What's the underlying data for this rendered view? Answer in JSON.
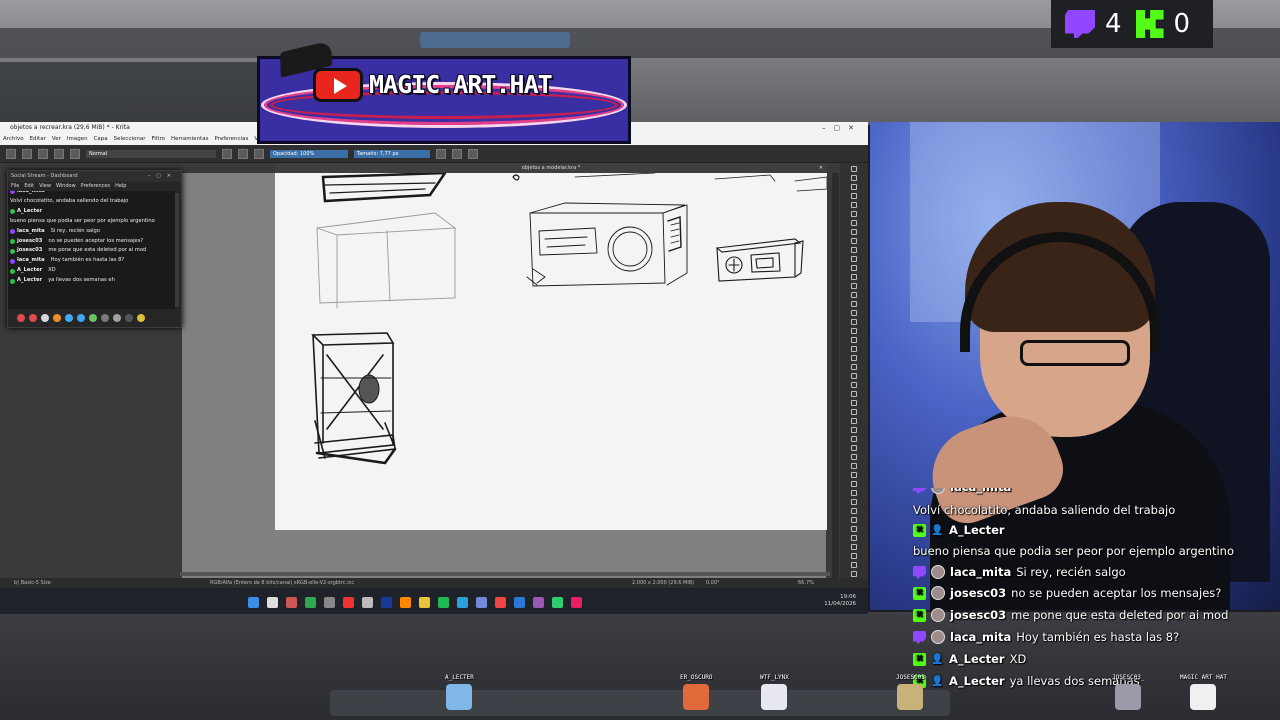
{
  "krita": {
    "title": "objetos a recrear.kra (29,6 MiB) * - Krita",
    "menu": [
      "Archivo",
      "Editar",
      "Ver",
      "Imagen",
      "Capa",
      "Seleccionar",
      "Filtro",
      "Herramientas",
      "Preferencias",
      "Ventana"
    ],
    "toolbar": {
      "blend_mode": "Normal",
      "opacity": "Opacidad: 100%",
      "size": "Tamaño: 7,77 px"
    },
    "doc_tab": "objetos a modelar.kra *",
    "status": {
      "brush": "b) Basic-5 Size",
      "color_model": "RGB/Alfa (Entero de 8 bits/canal)  sRGB-elle-V2-srgbtrc.icc",
      "dimensions": "2.000 x 2.000 (29,6 MiB)",
      "angle": "0,00°",
      "zoom": "66,7%"
    }
  },
  "taskbar": {
    "time": "19:06",
    "date": "11/04/2026"
  },
  "social_stream": {
    "title": "Social Stream - Dashboard",
    "menu": [
      "File",
      "Edit",
      "View",
      "Window",
      "Preferences",
      "Help"
    ],
    "lines": [
      {
        "type": "msg",
        "text": "Volví chocolatito, andaba saliendo del trabajo"
      },
      {
        "type": "user",
        "platform": "kick",
        "name": "A_Lecter"
      },
      {
        "type": "msg",
        "text": "bueno piensa que podia ser peor por ejemplo argentino"
      },
      {
        "type": "user",
        "platform": "twitch",
        "name": "laca_mita",
        "text": "Si rey, recién salgo"
      },
      {
        "type": "user",
        "platform": "kick",
        "name": "josesc03",
        "text": "no se pueden aceptar los mensajes?"
      },
      {
        "type": "user",
        "platform": "kick",
        "name": "josesc03",
        "text": "me pone que esta deleted por ai mod"
      },
      {
        "type": "user",
        "platform": "twitch",
        "name": "laca_mita",
        "text": "Hoy también es hasta las 8?"
      },
      {
        "type": "user",
        "platform": "kick",
        "name": "A_Lecter",
        "text": "XD"
      },
      {
        "type": "user",
        "platform": "kick",
        "name": "A_Lecter",
        "text": "ya llevas dos semanas eh"
      }
    ],
    "first_partial_user": "laca_mita"
  },
  "logo": {
    "text": "MAGIC.ART.HAT"
  },
  "counters": {
    "twitch": "4",
    "kick": "0"
  },
  "overlay_chat": [
    {
      "kind": "user",
      "platform": "twitch",
      "name": "laca_mita",
      "text": ""
    },
    {
      "kind": "msg",
      "text": "Volví chocolatito, andaba saliendo del trabajo"
    },
    {
      "kind": "user",
      "platform": "kick",
      "name": "A_Lecter",
      "text": ""
    },
    {
      "kind": "msg",
      "text": "bueno piensa que podia ser peor por ejemplo argentino"
    },
    {
      "kind": "user",
      "platform": "twitch",
      "name": "laca_mita",
      "text": "Si rey, recién salgo"
    },
    {
      "kind": "user",
      "platform": "kick",
      "name": "josesc03",
      "text": "no se pueden aceptar los mensajes?"
    },
    {
      "kind": "user",
      "platform": "kick",
      "name": "josesc03",
      "text": "me pone que esta deleted por ai mod"
    },
    {
      "kind": "user",
      "platform": "twitch",
      "name": "laca_mita",
      "text": "Hoy también es hasta las 8?"
    },
    {
      "kind": "user",
      "platform": "kick",
      "name": "A_Lecter",
      "text": "XD"
    },
    {
      "kind": "user",
      "platform": "kick",
      "name": "A_Lecter",
      "text": "ya llevas dos semanas"
    }
  ],
  "characters": [
    "A_LECTER",
    "ER_OSCURO",
    "WTF_LYNX",
    "JOSESC03",
    "JOSESC03_",
    "MAGIC ART HAT"
  ],
  "colors": {
    "twitch": "#9147ff",
    "kick": "#53fc18",
    "logo_panel": "#3a2ea3"
  }
}
